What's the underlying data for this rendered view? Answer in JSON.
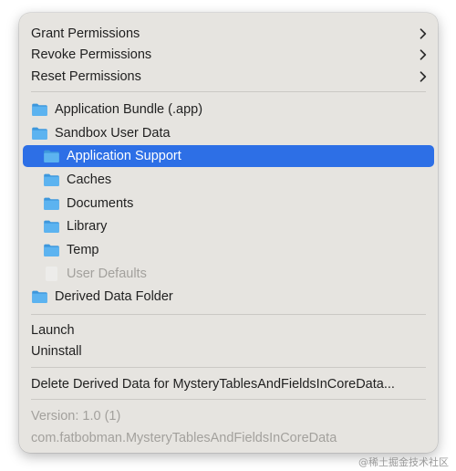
{
  "menu": {
    "permissions": [
      {
        "label": "Grant Permissions"
      },
      {
        "label": "Revoke Permissions"
      },
      {
        "label": "Reset Permissions"
      }
    ],
    "folders": {
      "application_bundle": "Application Bundle (.app)",
      "sandbox_user_data": "Sandbox User Data",
      "application_support": "Application Support",
      "caches": "Caches",
      "documents": "Documents",
      "library": "Library",
      "temp": "Temp",
      "user_defaults": "User Defaults",
      "derived_data_folder": "Derived Data Folder"
    },
    "actions": {
      "launch": "Launch",
      "uninstall": "Uninstall",
      "delete_derived": "Delete Derived Data for MysteryTablesAndFieldsInCoreData..."
    },
    "info": {
      "version": "Version: 1.0 (1)",
      "bundle_id": "com.fatbobman.MysteryTablesAndFieldsInCoreData"
    }
  },
  "watermark": "@稀土掘金技术社区",
  "colors": {
    "menu_background": "#e6e4e0",
    "highlight": "#2d6fe6",
    "folder_icon": "#4aa6ea",
    "disabled_text": "#a3a19d"
  },
  "icons": {
    "folder": "folder-icon",
    "submenu": "chevron-right-icon",
    "document": "document-icon"
  }
}
